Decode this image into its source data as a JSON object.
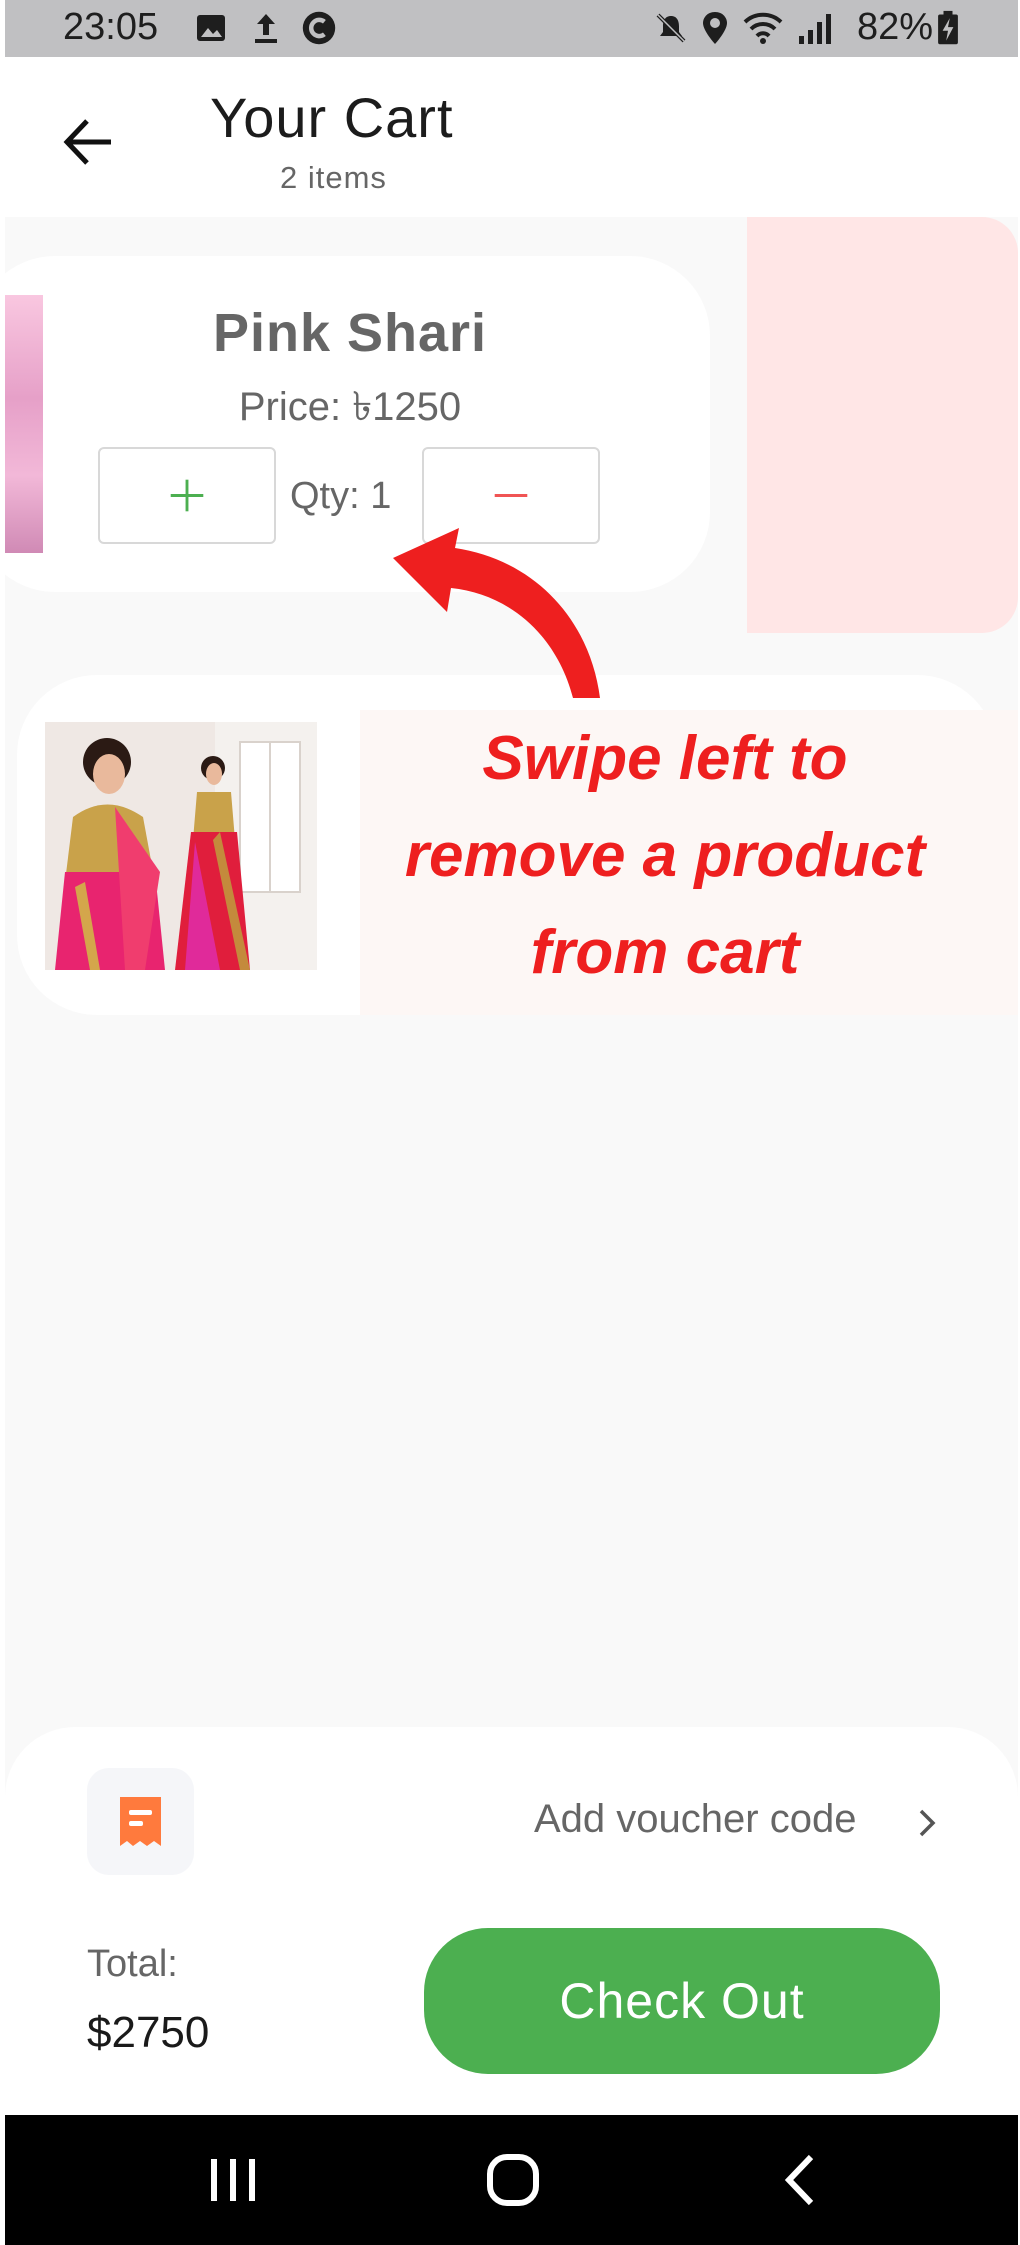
{
  "status_bar": {
    "time": "23:05",
    "battery": "82%",
    "left_icons": [
      "image-icon",
      "upload-icon",
      "c-icon"
    ],
    "right_icons": [
      "mute-icon",
      "location-icon",
      "wifi-icon",
      "signal-icon",
      "battery-charging-icon"
    ]
  },
  "header": {
    "title": "Your Cart",
    "subtitle": "2 items",
    "back_icon": "arrow-left-icon"
  },
  "cart": {
    "items": [
      {
        "name": "Pink Shari",
        "price": "Price: ৳1250",
        "qty": "Qty: 1",
        "increment_icon": "plus-icon",
        "decrement_icon": "minus-icon"
      },
      {
        "image": "saree-photo"
      }
    ]
  },
  "annotation": {
    "line1": "Swipe left to",
    "line2": "remove a product",
    "line3": "from cart",
    "color": "#ee1f1f"
  },
  "footer": {
    "voucher_label": "Add voucher code",
    "voucher_icon": "receipt-icon",
    "total_label": "Total:",
    "total_value": "$2750",
    "checkout_label": "Check Out",
    "checkout_color": "#4caf50"
  },
  "nav_bar": {
    "icons": [
      "recent-apps-icon",
      "home-icon",
      "back-icon"
    ]
  },
  "colors": {
    "accent_green": "#4caf50",
    "delete_bg": "#ffe6e6",
    "minus_red": "#f05454",
    "voucher_orange": "#ff7a3d"
  }
}
